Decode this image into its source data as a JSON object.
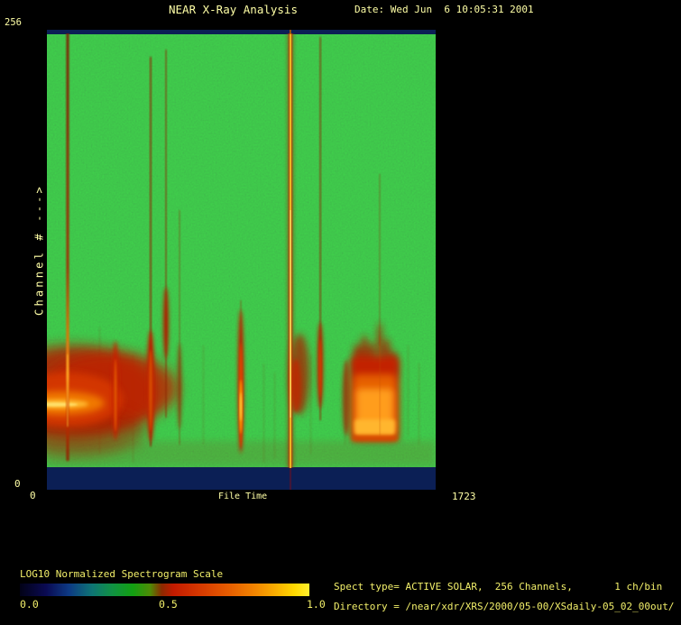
{
  "header": {
    "title": "NEAR X-Ray Analysis",
    "date": "Date: Wed Jun  6 10:05:31 2001"
  },
  "plot": {
    "y_axis": {
      "label": "Channel # --->",
      "top_tick": "256",
      "bottom_tick": "0"
    },
    "x_axis": {
      "label": "File Time",
      "left_tick": "0",
      "right_tick": "1723"
    }
  },
  "colorbar": {
    "title": "LOG10 Normalized Spectrogram Scale",
    "tick_left": "0.0",
    "tick_mid": "0.5",
    "tick_right": "1.0"
  },
  "info": {
    "spect_type_line": "Spect type= ACTIVE SOLAR,  256 Channels,       1 ch/bin",
    "directory_line": "Directory = /near/xdr/XRS/2000/05-00/XSdaily-05_02_00out/"
  },
  "colors": {
    "window_bg": "#000000",
    "text_pale": "#ffffa6",
    "text_yellow": "#f2ef6a",
    "plot_green": "#129312",
    "band_navy": "#0b1f55",
    "streak_red": "#c22200",
    "streak_bright": "#ffd22a"
  },
  "chart_data": {
    "type": "heatmap",
    "title": "NEAR X-Ray Analysis",
    "xlabel": "File Time",
    "ylabel": "Channel # --->",
    "xlim": [
      0,
      1723
    ],
    "ylim": [
      0,
      256
    ],
    "scale": {
      "label": "LOG10 Normalized Spectrogram Scale",
      "range": [
        0.0,
        1.0
      ],
      "ticks": [
        0.0,
        0.5,
        1.0
      ],
      "palette": "black-blue-green-red-yellow"
    },
    "background_level": 0.42,
    "features": [
      {
        "kind": "band",
        "desc": "saturated navy instrument-floor band",
        "time": [
          0,
          1723
        ],
        "channels": [
          0,
          12
        ],
        "level": 0.08
      },
      {
        "kind": "band",
        "desc": "navy band at top edge",
        "time": [
          0,
          1723
        ],
        "channels": [
          253,
          256
        ],
        "level": 0.08
      },
      {
        "kind": "blob",
        "desc": "broad low-channel continuum with bright horizontal core",
        "time": [
          0,
          430
        ],
        "channels": [
          24,
          75
        ],
        "level": 0.85,
        "peak_channels": [
          43,
          49
        ],
        "peak_level": 0.96
      },
      {
        "kind": "streak",
        "time": 92,
        "channels": [
          0,
          256
        ],
        "level": 0.78
      },
      {
        "kind": "streak",
        "time": 304,
        "channels": [
          22,
          82
        ],
        "level": 0.72
      },
      {
        "kind": "streak",
        "time": 460,
        "channels": [
          14,
          240
        ],
        "level": 0.72,
        "blob_channels": [
          28,
          92
        ]
      },
      {
        "kind": "streak",
        "time": 530,
        "channels": [
          40,
          246
        ],
        "level": 0.66,
        "blob_channels": [
          60,
          105
        ]
      },
      {
        "kind": "streak",
        "time": 588,
        "channels": [
          28,
          120
        ],
        "level": 0.58
      },
      {
        "kind": "streak",
        "time": 860,
        "channels": [
          22,
          100
        ],
        "level": 0.82,
        "peak_channels": [
          38,
          52
        ],
        "peak_level": 0.9
      },
      {
        "kind": "streak",
        "time": 1080,
        "channels": [
          0,
          256
        ],
        "level": 0.97,
        "desc": "brightest full-height yellow streak with red fringe"
      },
      {
        "kind": "streak",
        "time": 1212,
        "channels": [
          42,
          248
        ],
        "level": 0.7
      },
      {
        "kind": "streak",
        "time": 1476,
        "channels": [
          80,
          170
        ],
        "level": 0.55
      },
      {
        "kind": "blob",
        "desc": "blocky low-channel burst with flame-like top",
        "time": [
          1343,
          1572
        ],
        "channels": [
          26,
          86
        ],
        "level": 0.85,
        "peak_channels": [
          32,
          52
        ],
        "peak_level": 0.93
      }
    ]
  }
}
